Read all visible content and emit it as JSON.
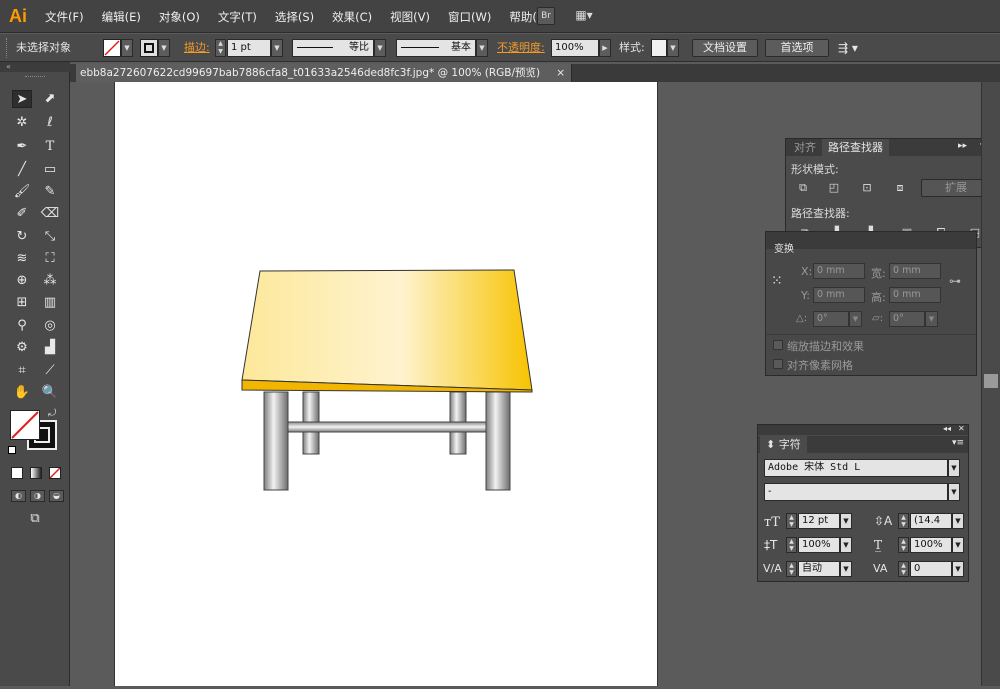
{
  "app": {
    "logo": "Ai"
  },
  "menu": [
    "文件(F)",
    "编辑(E)",
    "对象(O)",
    "文字(T)",
    "选择(S)",
    "效果(C)",
    "视图(V)",
    "窗口(W)",
    "帮助(H)"
  ],
  "menubar_buttons": {
    "bridge": "Br",
    "arrange": "▦▾"
  },
  "control_bar": {
    "selection_status": "未选择对象",
    "stroke_label": "描边:",
    "stroke_weight": "1 pt",
    "profile_uniform": "等比",
    "brush_basic": "基本",
    "opacity_label": "不透明度:",
    "opacity_value": "100%",
    "style_label": "样式:",
    "doc_setup": "文档设置",
    "preferences": "首选项"
  },
  "document_tab": {
    "title": "ebb8a272607622cd99697bab7886cfa8_t01633a2546ded8fc3f.jpg* @ 100% (RGB/预览)",
    "close": "×"
  },
  "align_panel": {
    "tab_align": "对齐",
    "tab_pathfinder": "路径查找器",
    "shape_modes_label": "形状模式:",
    "expand_button": "扩展",
    "pathfinders_label": "路径查找器:"
  },
  "transform_panel": {
    "tab": "变换",
    "x_label": "X:",
    "x_value": "0 mm",
    "y_label": "Y:",
    "y_value": "0 mm",
    "w_label": "宽:",
    "w_value": "0 mm",
    "h_label": "高:",
    "h_value": "0 mm",
    "rotate_value": "0°",
    "shear_value": "0°",
    "scale_strokes": "缩放描边和效果",
    "align_pixel": "对齐像素网格"
  },
  "character_panel": {
    "tab": "字符",
    "font_family": "Adobe 宋体 Std L",
    "font_style": "-",
    "font_size": "12 pt",
    "leading": "(14.4",
    "vertical_scale": "100%",
    "horizontal_scale": "100%",
    "kerning": "自动",
    "tracking": "0"
  },
  "colors": {
    "accent_orange": "#f29a2a",
    "table_top_light": "#fde89a",
    "table_top_dark": "#f7c300",
    "table_edge": "#f2b600"
  }
}
